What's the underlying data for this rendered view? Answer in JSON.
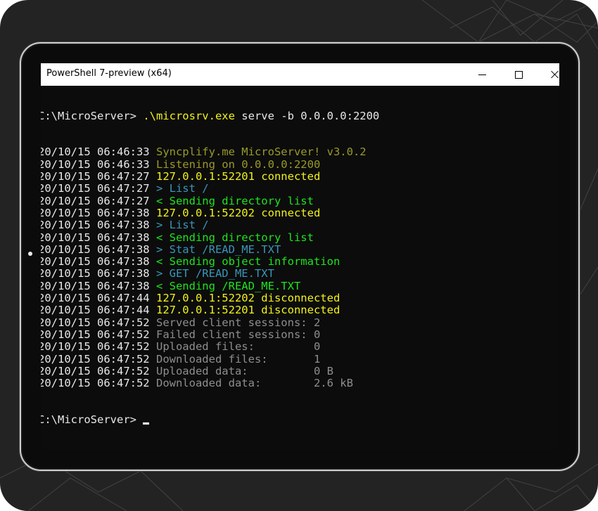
{
  "window": {
    "title": "PowerShell 7-preview (x64)"
  },
  "prompt": {
    "path": "C:\\MicroServer> ",
    "command": ".\\microsrv.exe",
    "args": " serve -b 0.0.0.0:2200"
  },
  "log": [
    {
      "ts": "20/10/15 06:46:33",
      "msg": "Syncplify.me MicroServer! v3.0.2",
      "color": "olive"
    },
    {
      "ts": "20/10/15 06:46:33",
      "msg": "Listening on 0.0.0.0:2200",
      "color": "olive"
    },
    {
      "ts": "20/10/15 06:47:27",
      "msg": "127.0.0.1:52201 connected",
      "color": "yellow"
    },
    {
      "ts": "20/10/15 06:47:27",
      "msg": "> List /",
      "color": "cyan"
    },
    {
      "ts": "20/10/15 06:47:27",
      "msg": "< Sending directory list",
      "color": "green"
    },
    {
      "ts": "20/10/15 06:47:38",
      "msg": "127.0.0.1:52202 connected",
      "color": "yellow"
    },
    {
      "ts": "20/10/15 06:47:38",
      "msg": "> List /",
      "color": "cyan"
    },
    {
      "ts": "20/10/15 06:47:38",
      "msg": "< Sending directory list",
      "color": "green"
    },
    {
      "ts": "20/10/15 06:47:38",
      "msg": "> Stat /READ_ME.TXT",
      "color": "cyan"
    },
    {
      "ts": "20/10/15 06:47:38",
      "msg": "< Sending object information",
      "color": "green"
    },
    {
      "ts": "20/10/15 06:47:38",
      "msg": "> GET /READ_ME.TXT",
      "color": "cyan"
    },
    {
      "ts": "20/10/15 06:47:38",
      "msg": "< Sending /READ_ME.TXT",
      "color": "green"
    },
    {
      "ts": "20/10/15 06:47:44",
      "msg": "127.0.0.1:52202 disconnected",
      "color": "yellow"
    },
    {
      "ts": "20/10/15 06:47:44",
      "msg": "127.0.0.1:52201 disconnected",
      "color": "yellow"
    },
    {
      "ts": "20/10/15 06:47:52",
      "msg": "Served client sessions: 2",
      "color": "gray"
    },
    {
      "ts": "20/10/15 06:47:52",
      "msg": "Failed client sessions: 0",
      "color": "gray"
    },
    {
      "ts": "20/10/15 06:47:52",
      "msg": "Uploaded files:         0",
      "color": "gray"
    },
    {
      "ts": "20/10/15 06:47:52",
      "msg": "Downloaded files:       1",
      "color": "gray"
    },
    {
      "ts": "20/10/15 06:47:52",
      "msg": "Uploaded data:          0 B",
      "color": "gray"
    },
    {
      "ts": "20/10/15 06:47:52",
      "msg": "Downloaded data:        2.6 kB",
      "color": "gray"
    }
  ],
  "final_prompt": {
    "path": "C:\\MicroServer> "
  },
  "colors": {
    "background": "#0c0c0c",
    "olive": "#9a9a2a",
    "yellow": "#f2f21c",
    "cyan": "#3a96b8",
    "green": "#1ee41e",
    "gray": "#8e8e8e"
  }
}
